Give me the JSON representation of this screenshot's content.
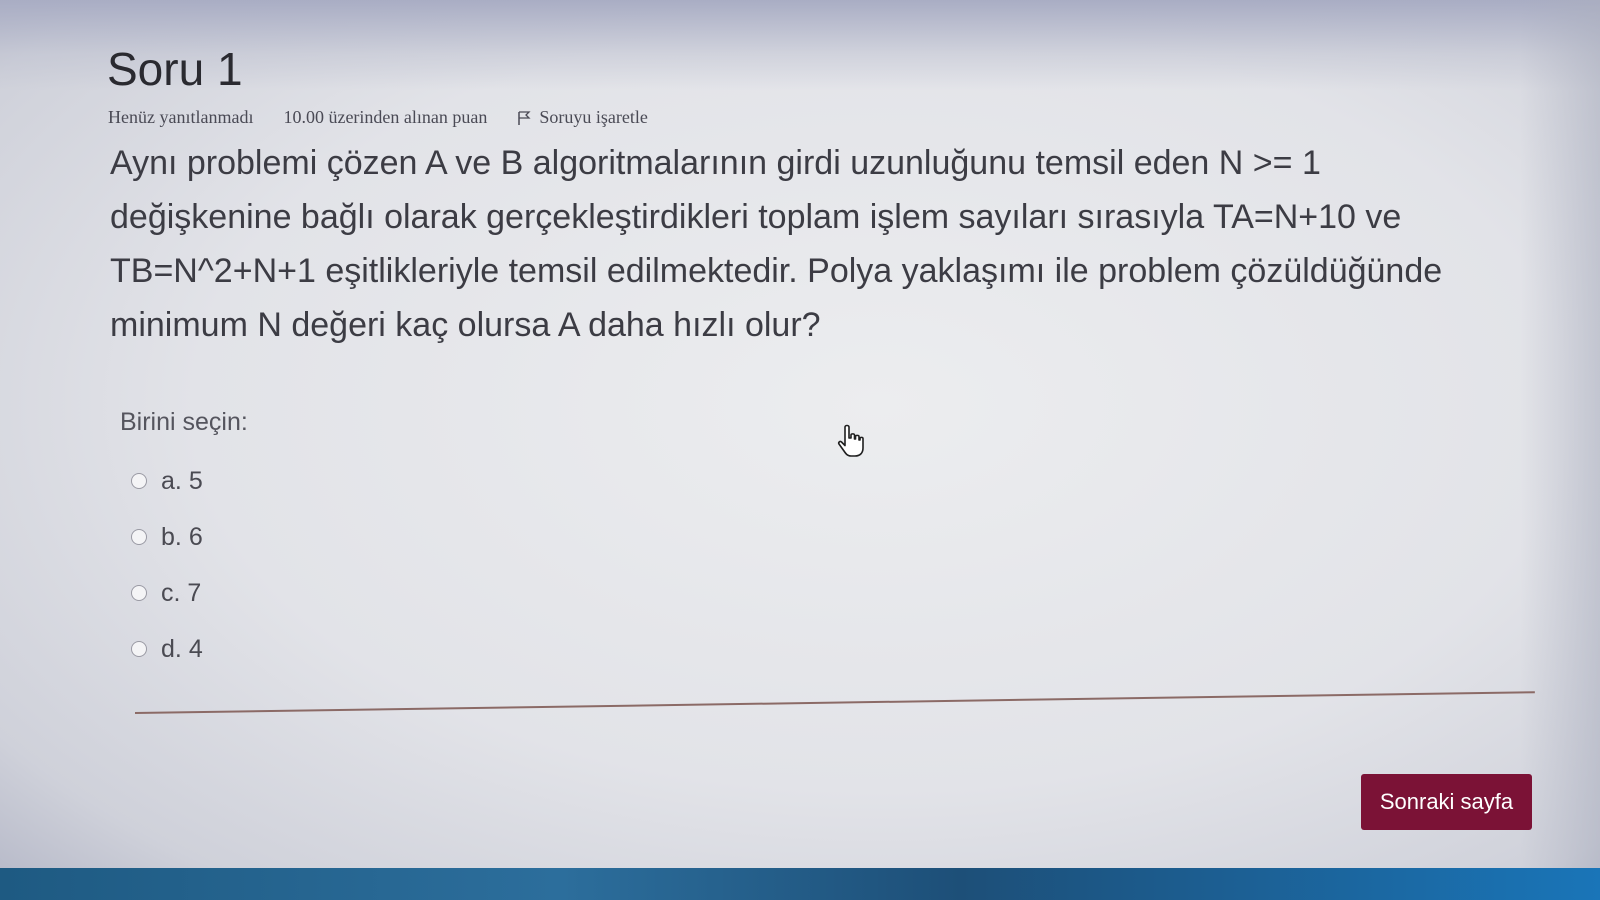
{
  "question": {
    "title": "Soru 1",
    "status": "Henüz yanıtlanmadı",
    "grade": "10.00 üzerinden alınan puan",
    "flag_label": "Soruyu işaretle",
    "text": "Aynı problemi çözen A ve B algoritmalarının girdi uzunluğunu temsil eden N >= 1 değişkenine bağlı olarak gerçekleştirdikleri toplam işlem sayıları sırasıyla TA=N+10 ve TB=N^2+N+1 eşitlikleriyle temsil edilmektedir. Polya yaklaşımı ile problem çözüldüğünde minimum N değeri kaç olursa A daha hızlı olur?"
  },
  "answer": {
    "prompt": "Birini seçin:",
    "options": [
      {
        "letter": "a.",
        "value": "5",
        "selected": false
      },
      {
        "letter": "b.",
        "value": "6",
        "selected": false
      },
      {
        "letter": "c.",
        "value": "7",
        "selected": false
      },
      {
        "letter": "d.",
        "value": "4",
        "selected": false
      }
    ]
  },
  "navigation": {
    "next_label": "Sonraki sayfa"
  },
  "colors": {
    "button": "#7b1236",
    "divider": "#8b6a66",
    "taskbar": "#1e5a82"
  },
  "icons": {
    "flag": "flag-icon",
    "cursor": "hand-pointer-icon"
  }
}
